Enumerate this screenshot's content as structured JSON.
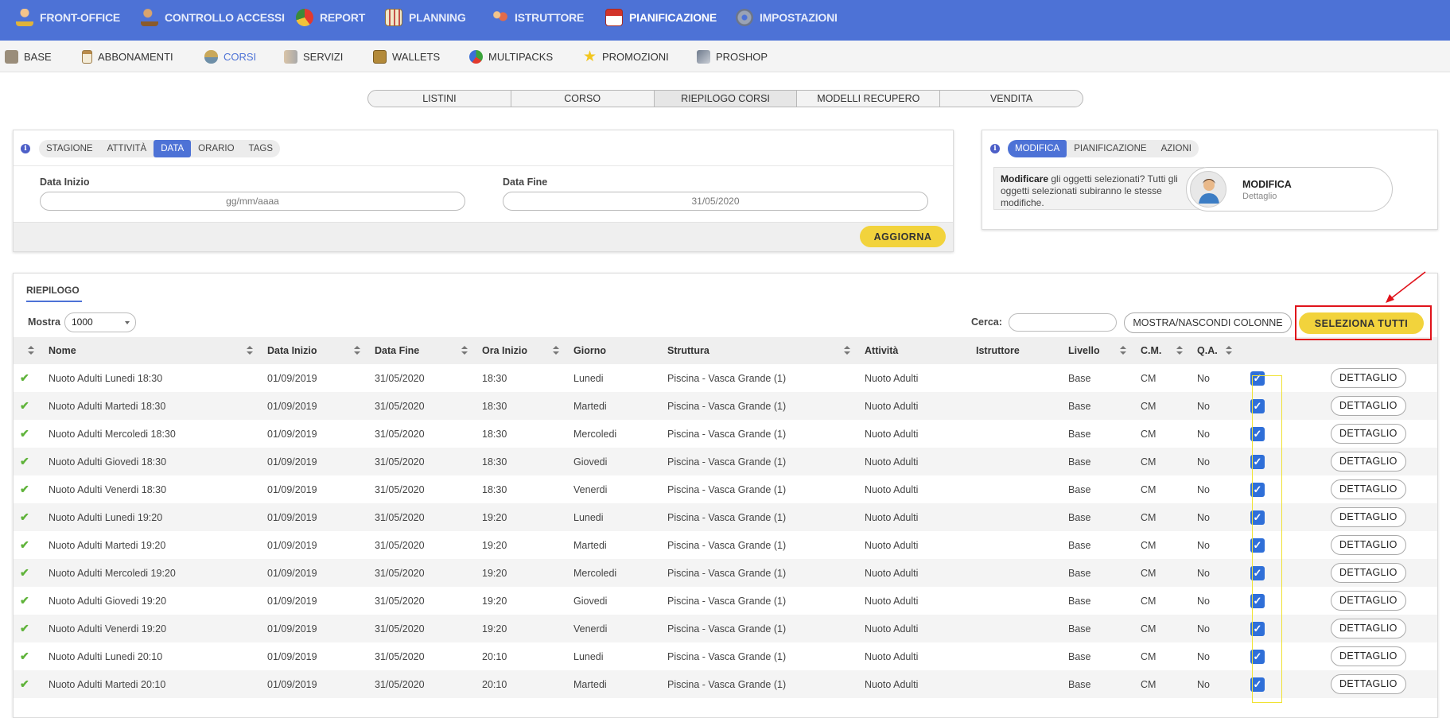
{
  "topnav": {
    "items": [
      {
        "label": "FRONT-OFFICE",
        "icon": "person-icon"
      },
      {
        "label": "CONTROLLO ACCESSI",
        "icon": "access-control-icon"
      },
      {
        "label": "REPORT",
        "icon": "pie-chart-icon"
      },
      {
        "label": "PLANNING",
        "icon": "calendar-grid-icon"
      },
      {
        "label": "ISTRUTTORE",
        "icon": "instructor-icon"
      },
      {
        "label": "PIANIFICAZIONE",
        "icon": "calendar-icon"
      },
      {
        "label": "IMPOSTAZIONI",
        "icon": "gear-icon"
      }
    ],
    "active": "PIANIFICAZIONE",
    "color": "#4d72d6"
  },
  "subnav": {
    "items": [
      {
        "label": "BASE",
        "icon": "box-icon"
      },
      {
        "label": "ABBONAMENTI",
        "icon": "clipboard-icon"
      },
      {
        "label": "CORSI",
        "icon": "swimmer-icon"
      },
      {
        "label": "SERVIZI",
        "icon": "handshake-icon"
      },
      {
        "label": "WALLETS",
        "icon": "wallet-icon"
      },
      {
        "label": "MULTIPACKS",
        "icon": "multipack-icon"
      },
      {
        "label": "PROMOZIONI",
        "icon": "star-icon"
      },
      {
        "label": "PROSHOP",
        "icon": "cards-icon"
      }
    ],
    "active": "CORSI"
  },
  "tabs": {
    "items": [
      "LISTINI",
      "CORSO",
      "RIEPILOGO CORSI",
      "MODELLI RECUPERO",
      "VENDITA"
    ],
    "active": "RIEPILOGO CORSI"
  },
  "filter": {
    "info": "i",
    "tabs": [
      "STAGIONE",
      "ATTIVITÀ",
      "DATA",
      "ORARIO",
      "TAGS"
    ],
    "active": "DATA",
    "start_label": "Data Inizio",
    "start_placeholder": "gg/mm/aaaa",
    "end_label": "Data Fine",
    "end_value": "31/05/2020",
    "update_button": "AGGIORNA"
  },
  "actions": {
    "info": "i",
    "tabs": [
      "MODIFICA",
      "PIANIFICAZIONE",
      "AZIONI"
    ],
    "active": "MODIFICA",
    "message_bold": "Modificare",
    "message_rest": " gli oggetti selezionati? Tutti gli oggetti selezionati subiranno le stesse modifiche.",
    "card_title": "MODIFICA",
    "card_subtitle": "Dettaglio"
  },
  "summary": {
    "title": "RIEPILOGO",
    "show_label": "Mostra",
    "show_value": "1000",
    "search_label": "Cerca:",
    "columns_button": "MOSTRA/NASCONDI COLONNE",
    "select_all_button": "SELEZIONA TUTTI",
    "columns": [
      "",
      "Nome",
      "Data Inizio",
      "Data Fine",
      "Ora Inizio",
      "Giorno",
      "Struttura",
      "Attività",
      "Istruttore",
      "Livello",
      "C.M.",
      "Q.A.",
      "",
      ""
    ],
    "detail_label": "DETTAGLIO",
    "check_symbol": "✔",
    "checkbox_symbol": "✓",
    "rows": [
      {
        "nome": "Nuoto Adulti Lunedi 18:30",
        "inizio": "01/09/2019",
        "fine": "31/05/2020",
        "ora": "18:30",
        "giorno": "Lunedi",
        "struttura": "Piscina - Vasca Grande (1)",
        "attivita": "Nuoto Adulti",
        "istruttore": "",
        "livello": "Base",
        "cm": "CM",
        "qa": "No"
      },
      {
        "nome": "Nuoto Adulti Martedi 18:30",
        "inizio": "01/09/2019",
        "fine": "31/05/2020",
        "ora": "18:30",
        "giorno": "Martedi",
        "struttura": "Piscina - Vasca Grande (1)",
        "attivita": "Nuoto Adulti",
        "istruttore": "",
        "livello": "Base",
        "cm": "CM",
        "qa": "No"
      },
      {
        "nome": "Nuoto Adulti Mercoledi 18:30",
        "inizio": "01/09/2019",
        "fine": "31/05/2020",
        "ora": "18:30",
        "giorno": "Mercoledi",
        "struttura": "Piscina - Vasca Grande (1)",
        "attivita": "Nuoto Adulti",
        "istruttore": "",
        "livello": "Base",
        "cm": "CM",
        "qa": "No"
      },
      {
        "nome": "Nuoto Adulti Giovedi 18:30",
        "inizio": "01/09/2019",
        "fine": "31/05/2020",
        "ora": "18:30",
        "giorno": "Giovedi",
        "struttura": "Piscina - Vasca Grande (1)",
        "attivita": "Nuoto Adulti",
        "istruttore": "",
        "livello": "Base",
        "cm": "CM",
        "qa": "No"
      },
      {
        "nome": "Nuoto Adulti Venerdi 18:30",
        "inizio": "01/09/2019",
        "fine": "31/05/2020",
        "ora": "18:30",
        "giorno": "Venerdi",
        "struttura": "Piscina - Vasca Grande (1)",
        "attivita": "Nuoto Adulti",
        "istruttore": "",
        "livello": "Base",
        "cm": "CM",
        "qa": "No"
      },
      {
        "nome": "Nuoto Adulti Lunedi 19:20",
        "inizio": "01/09/2019",
        "fine": "31/05/2020",
        "ora": "19:20",
        "giorno": "Lunedi",
        "struttura": "Piscina - Vasca Grande (1)",
        "attivita": "Nuoto Adulti",
        "istruttore": "",
        "livello": "Base",
        "cm": "CM",
        "qa": "No"
      },
      {
        "nome": "Nuoto Adulti Martedi 19:20",
        "inizio": "01/09/2019",
        "fine": "31/05/2020",
        "ora": "19:20",
        "giorno": "Martedi",
        "struttura": "Piscina - Vasca Grande (1)",
        "attivita": "Nuoto Adulti",
        "istruttore": "",
        "livello": "Base",
        "cm": "CM",
        "qa": "No"
      },
      {
        "nome": "Nuoto Adulti Mercoledi 19:20",
        "inizio": "01/09/2019",
        "fine": "31/05/2020",
        "ora": "19:20",
        "giorno": "Mercoledi",
        "struttura": "Piscina - Vasca Grande (1)",
        "attivita": "Nuoto Adulti",
        "istruttore": "",
        "livello": "Base",
        "cm": "CM",
        "qa": "No"
      },
      {
        "nome": "Nuoto Adulti Giovedi 19:20",
        "inizio": "01/09/2019",
        "fine": "31/05/2020",
        "ora": "19:20",
        "giorno": "Giovedi",
        "struttura": "Piscina - Vasca Grande (1)",
        "attivita": "Nuoto Adulti",
        "istruttore": "",
        "livello": "Base",
        "cm": "CM",
        "qa": "No"
      },
      {
        "nome": "Nuoto Adulti Venerdi 19:20",
        "inizio": "01/09/2019",
        "fine": "31/05/2020",
        "ora": "19:20",
        "giorno": "Venerdi",
        "struttura": "Piscina - Vasca Grande (1)",
        "attivita": "Nuoto Adulti",
        "istruttore": "",
        "livello": "Base",
        "cm": "CM",
        "qa": "No"
      },
      {
        "nome": "Nuoto Adulti Lunedi 20:10",
        "inizio": "01/09/2019",
        "fine": "31/05/2020",
        "ora": "20:10",
        "giorno": "Lunedi",
        "struttura": "Piscina - Vasca Grande (1)",
        "attivita": "Nuoto Adulti",
        "istruttore": "",
        "livello": "Base",
        "cm": "CM",
        "qa": "No"
      },
      {
        "nome": "Nuoto Adulti Martedi 20:10",
        "inizio": "01/09/2019",
        "fine": "31/05/2020",
        "ora": "20:10",
        "giorno": "Martedi",
        "struttura": "Piscina - Vasca Grande (1)",
        "attivita": "Nuoto Adulti",
        "istruttore": "",
        "livello": "Base",
        "cm": "CM",
        "qa": "No"
      }
    ]
  },
  "colors": {
    "accent": "#4d72d6",
    "button_yellow": "#f2d33c",
    "highlight_red": "#e0131b",
    "check_green": "#5fb33a",
    "checkbox_blue": "#2f6fd8"
  }
}
